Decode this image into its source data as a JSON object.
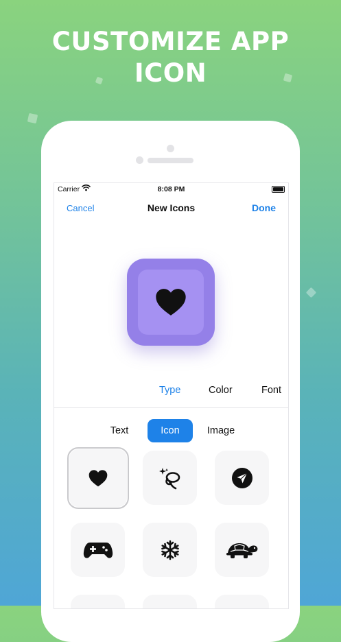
{
  "headline": {
    "line1": "CUSTOMIZE APP",
    "line2": "ICON"
  },
  "status_bar": {
    "carrier": "Carrier",
    "time": "8:08 PM"
  },
  "nav": {
    "cancel": "Cancel",
    "title": "New Icons",
    "done": "Done"
  },
  "preview": {
    "icon": "heart-icon",
    "background_color": "#9480e8",
    "icon_color": "#111111"
  },
  "style_segments": {
    "type": "Type",
    "color": "Color",
    "font": "Font",
    "selected": "Type"
  },
  "source_tabs": {
    "text": "Text",
    "icon": "Icon",
    "image": "Image",
    "selected": "Icon"
  },
  "icon_grid": [
    {
      "icon": "heart-icon",
      "selected": true
    },
    {
      "icon": "sparkle-lasso-icon",
      "selected": false
    },
    {
      "icon": "paperplane-circle-icon",
      "selected": false
    },
    {
      "icon": "gamecontroller-icon",
      "selected": false
    },
    {
      "icon": "snowflake-icon",
      "selected": false
    },
    {
      "icon": "tortoise-icon",
      "selected": false
    }
  ],
  "colors": {
    "accent": "#1e82e8",
    "icon_ink": "#111111",
    "tile_bg": "#f6f6f7"
  }
}
